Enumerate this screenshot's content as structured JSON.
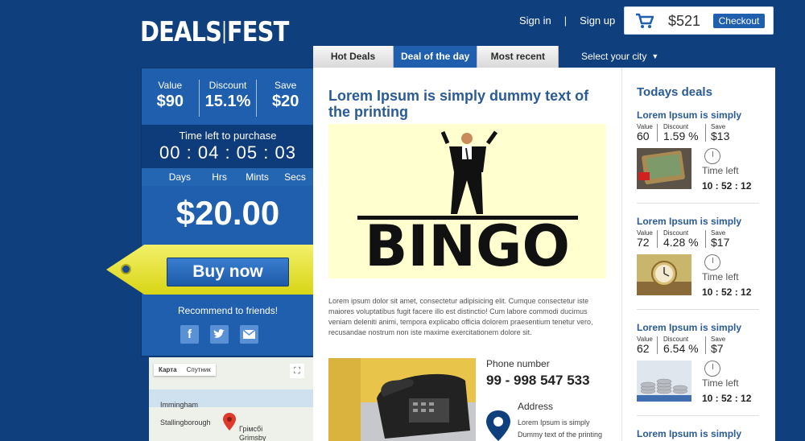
{
  "header": {
    "logo_left": "DEALS",
    "logo_right": "FEST",
    "sign_in": "Sign in",
    "divider": "|",
    "sign_up": "Sign up",
    "cart_amount": "$521",
    "checkout": "Checkout"
  },
  "tabs": [
    "Hot Deals",
    "Deal of the day",
    "Most recent"
  ],
  "city_select": "Select your city",
  "deal_panel": {
    "stats": [
      {
        "label": "Value",
        "value": "$90"
      },
      {
        "label": "Discount",
        "value": "15.1%"
      },
      {
        "label": "Save",
        "value": "$20"
      }
    ],
    "time_left_label": "Time left to purchase",
    "timer": "00 : 04 : 05 : 03",
    "units": [
      "Days",
      "Hrs",
      "Mints",
      "Secs"
    ],
    "price": "$20.00",
    "buy_label": "Buy now",
    "recommend": "Recommend to friends!"
  },
  "map": {
    "tab_map": "Карта",
    "tab_satellite": "Спутник",
    "labels": [
      "Immingham",
      "Stallingborough",
      "Грімсбі",
      "Grimsby"
    ]
  },
  "main": {
    "headline": "Lorem Ipsum is simply dummy text of the printing",
    "hero_word": "BINGO",
    "description": "Lorem ipsum dolor sit amet, consectetur adipisicing elit. Cumque consectetur iste maiores voluptatibus fugit facere illo est distinctio! Cum labore commodi ducimus veniam deleniti animi, tempora explicabo officia dolorem praesentium tenetur vero, recusandae nostrum non iste maxime exercitationem dolore sit.",
    "phone_label": "Phone number",
    "phone_number": "99 - 998 547 533",
    "address_label": "Address",
    "address_line1": "Lorem Ipsum is simply",
    "address_line2": "Dummy text of the printing"
  },
  "sidebar": {
    "title": "Todays deals",
    "deals": [
      {
        "title": "Lorem Ipsum is simply",
        "value_label": "Value",
        "discount_label": "Discount",
        "save_label": "Save",
        "value": "60",
        "discount": "1.59 %",
        "save": "$13",
        "time_label": "Time left",
        "time": "10 : 52 : 12"
      },
      {
        "title": "Lorem Ipsum is simply",
        "value_label": "Value",
        "discount_label": "Discount",
        "save_label": "Save",
        "value": "72",
        "discount": "4.28 %",
        "save": "$17",
        "time_label": "Time left",
        "time": "10 : 52 : 12"
      },
      {
        "title": "Lorem Ipsum is simply",
        "value_label": "Value",
        "discount_label": "Discount",
        "save_label": "Save",
        "value": "62",
        "discount": "6.54 %",
        "save": "$7",
        "time_label": "Time left",
        "time": "10 : 52 : 12"
      },
      {
        "title": "Lorem Ipsum is simply"
      }
    ]
  },
  "icons": {
    "cart": "shopping-cart-icon",
    "facebook": "facebook-icon",
    "twitter": "twitter-icon",
    "mail": "mail-icon",
    "clock": "clock-icon",
    "map_pin": "map-pin-icon",
    "location": "location-pin-icon",
    "fullscreen": "fullscreen-icon"
  },
  "colors": {
    "background": "#0f3f7d",
    "accent": "#1f5fae",
    "heading": "#2a5b94",
    "tag": "#e4e12a"
  }
}
